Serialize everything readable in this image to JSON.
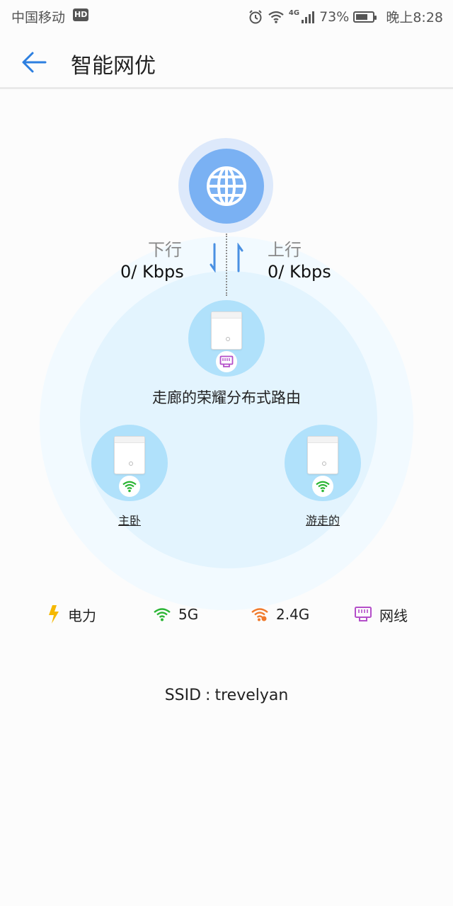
{
  "status_bar": {
    "carrier": "中国移动",
    "hd_badge": "HD",
    "network": "4G",
    "battery": "73%",
    "battery_level": 0.73,
    "time": "晚上8:28"
  },
  "app_bar": {
    "title": "智能网优",
    "back_icon": "arrow-left-icon"
  },
  "internet": {
    "icon": "globe-icon",
    "download": {
      "label": "下行",
      "value": "0/ Kbps"
    },
    "upload": {
      "label": "上行",
      "value": "0/ Kbps"
    }
  },
  "nodes": {
    "main": {
      "name": "走廊的荣耀分布式路由",
      "connection": "ethernet"
    },
    "left": {
      "name": "主卧",
      "connection": "5G"
    },
    "right": {
      "name": "游走的",
      "connection": "5G"
    }
  },
  "legend": [
    {
      "icon": "lightning-icon",
      "label": "电力",
      "color": "#f5b800"
    },
    {
      "icon": "wifi-5g-icon",
      "label": "5G",
      "color": "#2bb534"
    },
    {
      "icon": "wifi-24g-icon",
      "label": "2.4G",
      "color": "#f07a2c"
    },
    {
      "icon": "ethernet-icon",
      "label": "网线",
      "color": "#b44fc9"
    }
  ],
  "ssid": {
    "label": "SSID",
    "separator": ":",
    "value": "trevelyan"
  },
  "colors": {
    "accent": "#2d7fe0",
    "globe": "#7ab1f3",
    "node": "#b0e1fb",
    "wifi_5g": "#2bb534",
    "wifi_24g": "#f07a2c",
    "ethernet": "#b44fc9",
    "power": "#f5b800"
  }
}
